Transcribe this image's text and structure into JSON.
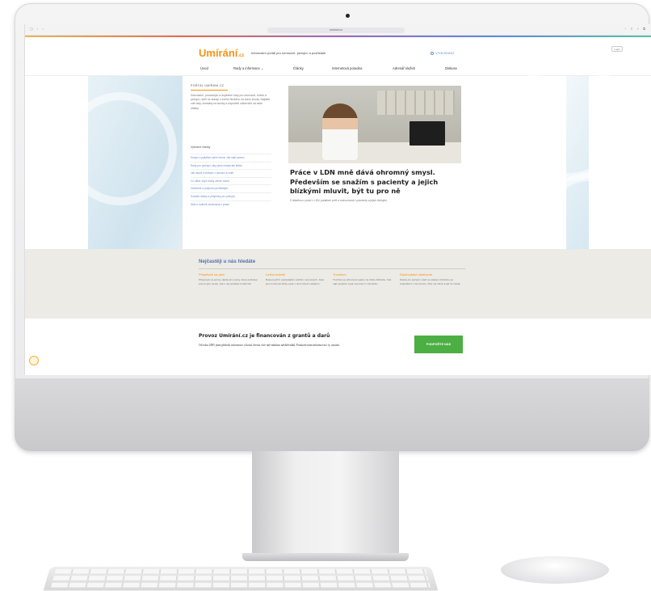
{
  "browser": {
    "nav_icons": "▢ ‹ ›",
    "url": "umirani.cz",
    "tool_icons": "◔ ⇧ + ⧉"
  },
  "header": {
    "logo": "Umírání",
    "logo_tld": ".cz",
    "tagline": "Informační portál pro nemocné, pečující a pozůstalé",
    "search": "VYHLEDÁNÍ",
    "login": "Login"
  },
  "nav": {
    "items": [
      "Úvod",
      "Rady a informace ⌄",
      "Články",
      "Internetová poradna",
      "Adresář služeb",
      "Diskuse"
    ]
  },
  "sidebar": {
    "portal_label": "PORTÁL UMÍRÁNÍ.CZ",
    "portal_desc": "Informační, provázející a doplněné rady pro nemocné, blízké a pečující, kteří se starají o svého blízkého na konci života. Najdete zde rady, kontakty na služby a odpovědi odborníků na vaše otázky.",
    "topics_label": "Vybrané články",
    "topics": [
      "Hospic a paliativní péče doma: Jak najít pomoc",
      "Rady pro pečující, aby péče nebyla tak těžká",
      "Jak mluvit s blízkým o umírání a smrti",
      "Co dělat, když blízký zemře doma",
      "Zármutek a podpora pozůstalých",
      "Sociální dávky a příspěvky pro pečující",
      "Stáž a rodinné zkušenosti z praxe"
    ]
  },
  "hero": {
    "title": "Práce v LDN mně dává ohromný smysl. Především se snažím s pacienty a jejich blízkými mluvit, být tu pro ně",
    "subtitle": "S lékařkou o práci v LDN, paliativní péči a rozhovorech s pacienty a jejich blízkými."
  },
  "faq": {
    "title": "Nejčastěji u nás hledáte",
    "columns": [
      {
        "heading": "Příspěvek na péči",
        "text": "Příspěvek na péči je dávka pro osoby, které potřebují pomoc jiné osoby. Jak o něj požádat a kolik činí."
      },
      {
        "heading": "Léčba bolesti",
        "text": "Bolest patří k nejčastějším potížím nemocných. Jaké jsou možnosti léčby a jak o nich mluvit s lékařem."
      },
      {
        "heading": "Truchlení",
        "text": "Truchlení je přirozená reakce na ztrátu blízkého. Kde najít podporu a jak si pomoci v zármutku."
      },
      {
        "heading": "Dlouhodobé ošetřovné",
        "text": "Dávka pro pečující, kteří se starají o blízkého po propuštění z nemocnice. Kdo má nárok a jak ho získat."
      }
    ]
  },
  "funding": {
    "title": "Provoz Umírání.cz je financován z grantů a darů",
    "text": "Od roku 2005 jsme přinesli informace o konci života více než milionu návštěvníků. Pomozte nám informovat i ty ostatní.",
    "button": "PODPOŘTE NÁS"
  },
  "colors": {
    "brand": "#f29417",
    "link": "#6b8ec9",
    "support": "#4caf43"
  }
}
